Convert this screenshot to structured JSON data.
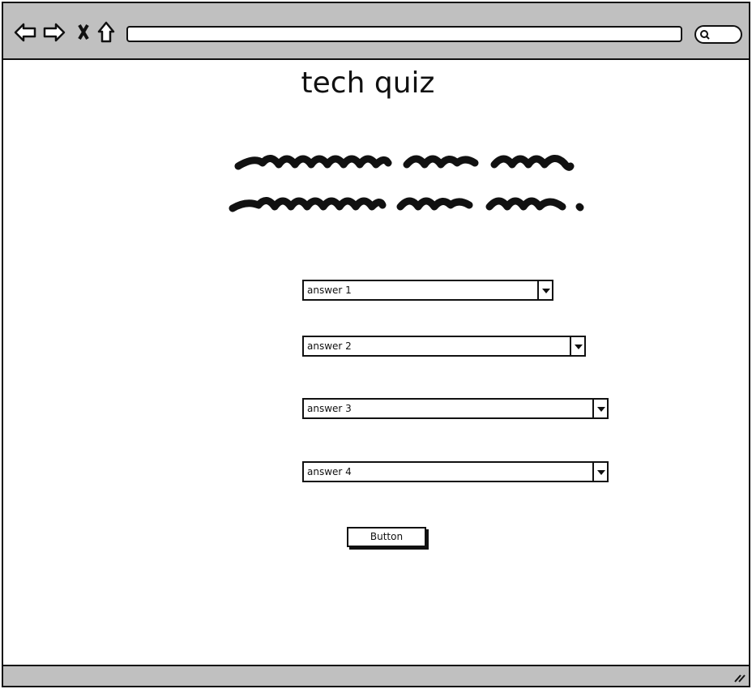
{
  "browser": {
    "nav_icons": [
      "back-arrow-icon",
      "forward-arrow-icon",
      "stop-x-icon",
      "home-icon"
    ],
    "url": "",
    "search_icon": "magnifier-icon"
  },
  "page": {
    "title": "tech quiz",
    "question_placeholder": "redacted-scribble-text",
    "answers": [
      {
        "value": "answer 1"
      },
      {
        "value": "answer 2"
      },
      {
        "value": "answer 3"
      },
      {
        "value": "answer 4"
      }
    ],
    "submit_label": "Button"
  }
}
